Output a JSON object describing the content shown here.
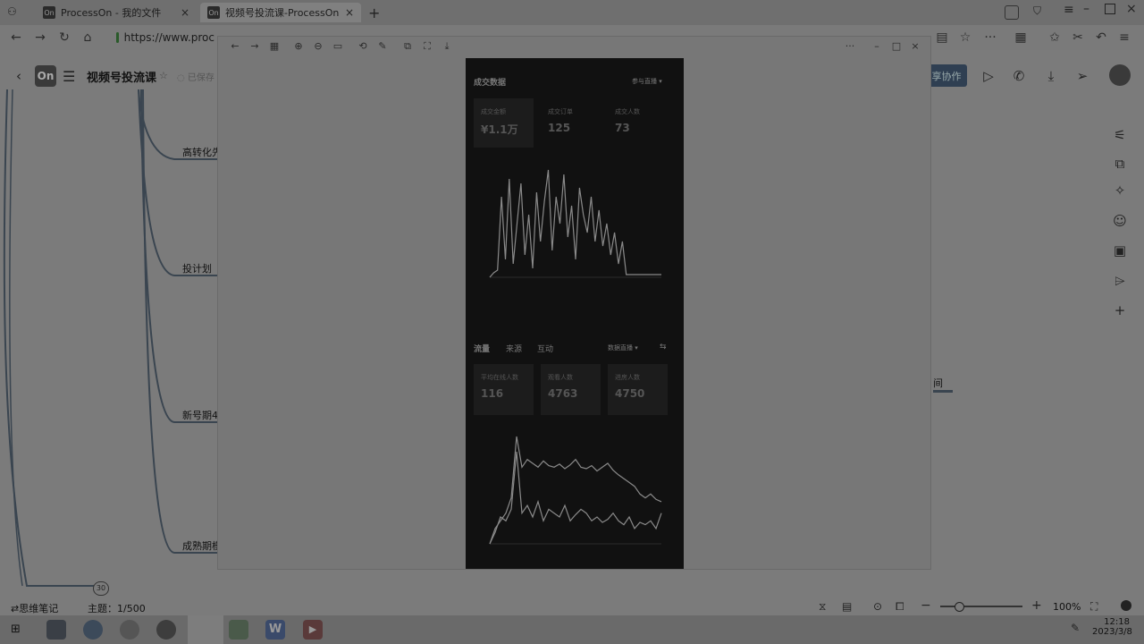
{
  "browser": {
    "tabs": [
      {
        "icon_text": "On",
        "title": "ProcessOn - 我的文件",
        "close": "×"
      },
      {
        "icon_text": "On",
        "title": "视频号投流课-ProcessOn",
        "close": "×"
      }
    ],
    "new_tab": "+",
    "url": "https://www.proc"
  },
  "app": {
    "logo_text": "On",
    "doc_title": "视频号投流课",
    "save_status": "已保存",
    "collab_label": "享协作"
  },
  "mindmap": {
    "nodes": [
      "高转化先",
      "投计划",
      "新号期4",
      "成熟期模"
    ],
    "right_fragment": "间",
    "count_badge": "30"
  },
  "status": {
    "mode_label": "思维笔记",
    "topic_count": "主题：1/500",
    "zoom": "100%",
    "zoom_minus": "−",
    "zoom_plus": "+"
  },
  "taskbar": {
    "time": "12:18",
    "date": "2023/3/8"
  },
  "viewer": {
    "overflow": "···",
    "min": "–",
    "max": "□",
    "close": "×"
  },
  "phone": {
    "section1_title": "成交数据",
    "section1_filter": "参与直播 ▾",
    "cards1": [
      {
        "label": "成交金额",
        "value": "¥1.1万"
      },
      {
        "label": "成交订单",
        "value": "125"
      },
      {
        "label": "成交人数",
        "value": "73"
      }
    ],
    "section2_tabs": [
      "流量",
      "来源",
      "互动"
    ],
    "section2_filter": "数据直播 ▾",
    "section2_extra": "⇆",
    "cards2": [
      {
        "label": "平均在线人数",
        "value": "116"
      },
      {
        "label": "观看人数",
        "value": "4763"
      },
      {
        "label": "进房人数",
        "value": "4750"
      }
    ]
  },
  "chart_data": [
    {
      "type": "line",
      "series": [
        {
          "values": [
            0,
            5,
            8,
            90,
            20,
            110,
            15,
            60,
            105,
            25,
            70,
            10,
            95,
            40,
            85,
            120,
            30,
            90,
            60,
            115,
            45,
            80,
            20,
            100,
            70,
            50,
            90,
            40,
            75,
            35,
            60,
            25,
            50,
            15,
            40,
            3,
            3,
            3,
            3,
            3,
            3,
            3,
            3,
            3,
            3
          ]
        }
      ],
      "colors": [
        "#8a8a8a"
      ]
    },
    {
      "type": "line",
      "series": [
        {
          "values": [
            0,
            20,
            30,
            40,
            60,
            140,
            100,
            110,
            105,
            100,
            108,
            102,
            100,
            104,
            98,
            103,
            110,
            100,
            98,
            102,
            95,
            100,
            105,
            96,
            90,
            85,
            80,
            75,
            65,
            60,
            65,
            58,
            55
          ]
        },
        {
          "values": [
            0,
            15,
            35,
            30,
            45,
            120,
            40,
            50,
            35,
            55,
            30,
            45,
            40,
            35,
            50,
            30,
            38,
            45,
            40,
            30,
            35,
            28,
            32,
            40,
            30,
            25,
            35,
            20,
            28,
            25,
            30,
            20,
            40
          ]
        }
      ],
      "colors": [
        "#8a8a8a",
        "#8a8a8a"
      ]
    }
  ]
}
